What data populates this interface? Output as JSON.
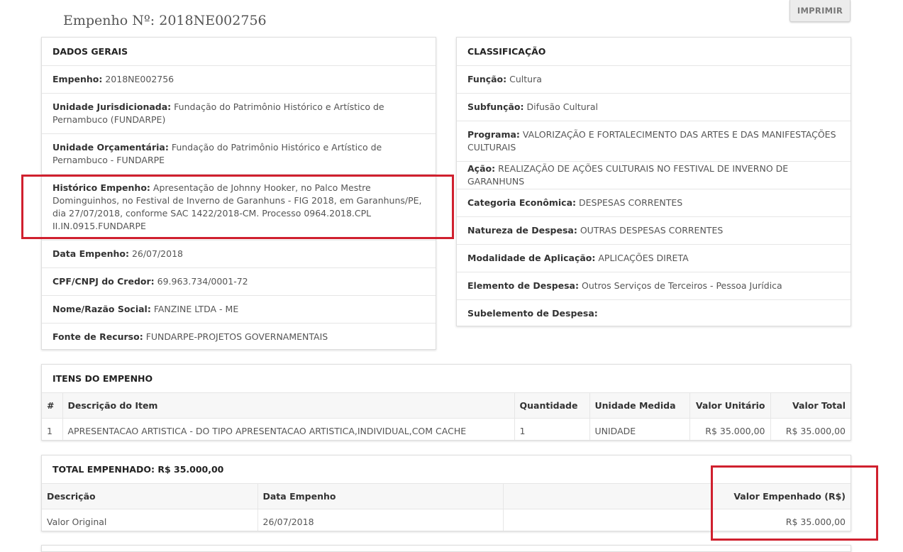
{
  "page": {
    "title": "Empenho Nº: 2018NE002756",
    "print_label": "IMPRIMIR"
  },
  "dados_gerais": {
    "header": "DADOS GERAIS",
    "rows": [
      {
        "label": "Empenho:",
        "value": "2018NE002756"
      },
      {
        "label": "Unidade Jurisdicionada:",
        "value": "Fundação do Patrimônio Histórico e Artístico de Pernambuco (FUNDARPE)"
      },
      {
        "label": "Unidade Orçamentária:",
        "value": "Fundação do Patrimônio Histórico e Artístico de Pernambuco - FUNDARPE"
      },
      {
        "label": "Histórico Empenho:",
        "value": "Apresentação de Johnny Hooker, no Palco Mestre Dominguinhos, no Festival de Inverno de Garanhuns - FIG 2018, em Garanhuns/PE, dia 27/07/2018, conforme SAC 1422/2018-CM. Processo 0964.2018.CPL II.IN.0915.FUNDARPE"
      },
      {
        "label": "Data Empenho:",
        "value": "26/07/2018"
      },
      {
        "label": "CPF/CNPJ do Credor:",
        "value": "69.963.734/0001-72"
      },
      {
        "label": "Nome/Razão Social:",
        "value": "FANZINE LTDA - ME"
      },
      {
        "label": "Fonte de Recurso:",
        "value": "FUNDARPE-PROJETOS GOVERNAMENTAIS"
      }
    ]
  },
  "classificacao": {
    "header": "CLASSIFICAÇÃO",
    "rows": [
      {
        "label": "Função:",
        "value": "Cultura"
      },
      {
        "label": "Subfunção:",
        "value": "Difusão Cultural"
      },
      {
        "label": "Programa:",
        "value": "VALORIZAÇÃO E FORTALECIMENTO DAS ARTES E DAS MANIFESTAÇÕES CULTURAIS"
      },
      {
        "label": "Ação:",
        "value": "REALIZAÇÃO DE AÇÕES CULTURAIS NO FESTIVAL DE INVERNO DE GARANHUNS"
      },
      {
        "label": "Categoria Econômica:",
        "value": "DESPESAS CORRENTES"
      },
      {
        "label": "Natureza de Despesa:",
        "value": "OUTRAS DESPESAS CORRENTES"
      },
      {
        "label": "Modalidade de Aplicação:",
        "value": "APLICAÇÕES DIRETA"
      },
      {
        "label": "Elemento de Despesa:",
        "value": "Outros Serviços de Terceiros - Pessoa Jurídica"
      },
      {
        "label": "Subelemento de Despesa:",
        "value": ""
      }
    ]
  },
  "itens": {
    "header": "ITENS DO EMPENHO",
    "columns": [
      "#",
      "Descrição do Item",
      "Quantidade",
      "Unidade Medida",
      "Valor Unitário",
      "Valor Total"
    ],
    "rows": [
      [
        "1",
        "APRESENTACAO ARTISTICA - DO TIPO APRESENTACAO ARTISTICA,INDIVIDUAL,COM CACHE",
        "1",
        "UNIDADE",
        "R$ 35.000,00",
        "R$ 35.000,00"
      ]
    ]
  },
  "total": {
    "header": "TOTAL EMPENHADO: R$ 35.000,00",
    "columns": [
      "Descrição",
      "Data Empenho",
      "",
      "Valor Empenhado (R$)"
    ],
    "rows": [
      [
        "Valor Original",
        "26/07/2018",
        "",
        "R$ 35.000,00"
      ]
    ]
  },
  "colors": {
    "highlight": "#d0202e",
    "border": "#dedede",
    "header_bg": "#f7f7f7"
  }
}
